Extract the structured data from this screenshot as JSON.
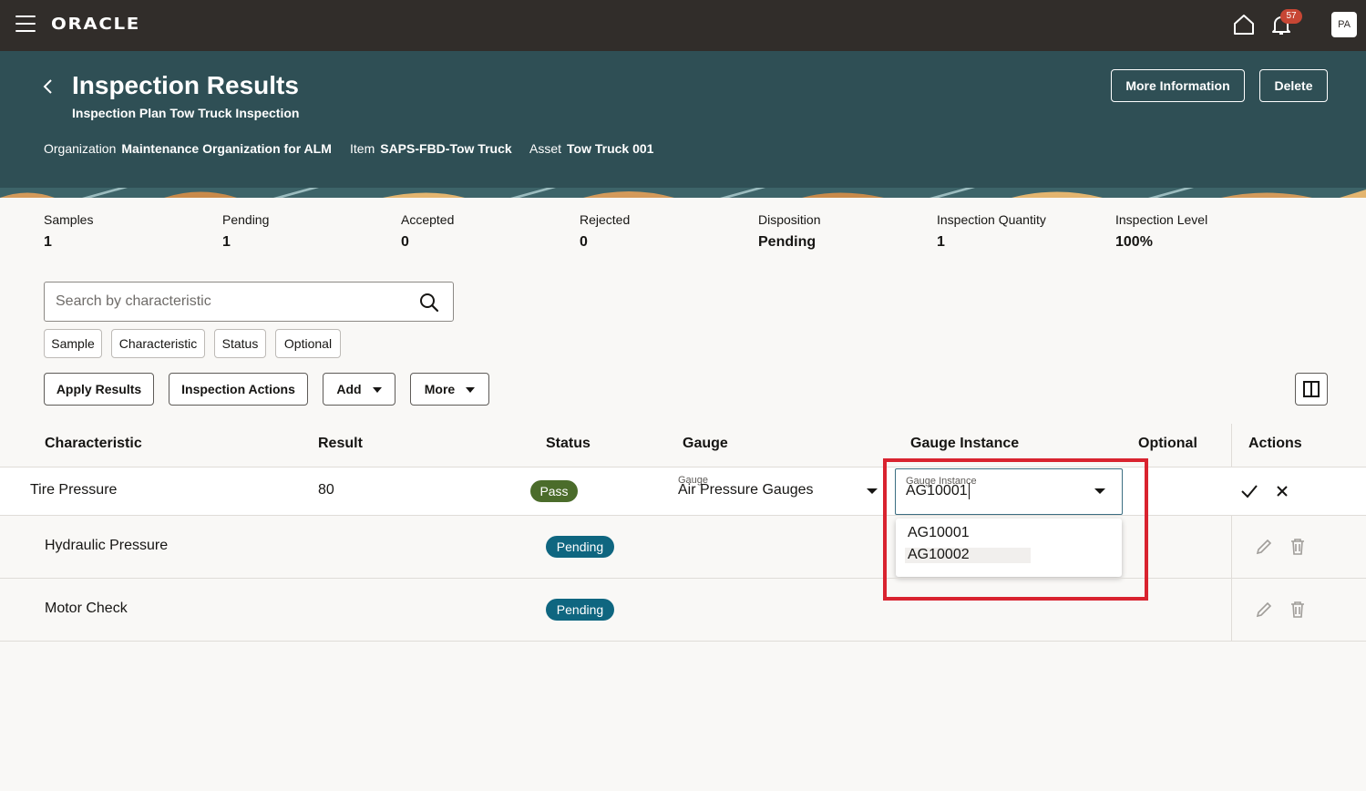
{
  "topbar": {
    "logo": "ORACLE",
    "notification_count": "57",
    "avatar_initials": "PA"
  },
  "header": {
    "title": "Inspection Results",
    "subtitle": "Inspection Plan Tow Truck Inspection",
    "context": [
      {
        "label": "Organization",
        "value": "Maintenance Organization for ALM"
      },
      {
        "label": "Item",
        "value": "SAPS-FBD-Tow Truck"
      },
      {
        "label": "Asset",
        "value": "Tow Truck 001"
      }
    ],
    "more_info_label": "More Information",
    "delete_label": "Delete",
    "colors": {
      "banner": "#2f4f55",
      "topbar": "#312d2a"
    }
  },
  "summary": [
    {
      "label": "Samples",
      "value": "1"
    },
    {
      "label": "Pending",
      "value": "1"
    },
    {
      "label": "Accepted",
      "value": "0"
    },
    {
      "label": "Rejected",
      "value": "0"
    },
    {
      "label": "Disposition",
      "value": "Pending"
    },
    {
      "label": "Inspection Quantity",
      "value": "1"
    },
    {
      "label": "Inspection Level",
      "value": "100%"
    }
  ],
  "search": {
    "placeholder": "Search by characteristic",
    "icon": "search-icon"
  },
  "filters": [
    "Sample",
    "Characteristic",
    "Status",
    "Optional"
  ],
  "toolbar": {
    "apply_results": "Apply Results",
    "inspection_actions": "Inspection Actions",
    "add": "Add",
    "more": "More"
  },
  "table": {
    "columns": [
      "Characteristic",
      "Result",
      "Status",
      "Gauge",
      "Gauge Instance",
      "Optional",
      "Actions"
    ],
    "rows": [
      {
        "characteristic": "Tire Pressure",
        "result": "80",
        "status": "Pass",
        "gauge_label": "Gauge",
        "gauge": "Air Pressure Gauges",
        "gauge_instance_label": "Gauge Instance",
        "gauge_instance": "AG10001"
      },
      {
        "characteristic": "Hydraulic Pressure",
        "result": "",
        "status": "Pending"
      },
      {
        "characteristic": "Motor Check",
        "result": "",
        "status": "Pending"
      }
    ],
    "status_colors": {
      "Pass": "#4b6c2b",
      "Pending": "#0f6680"
    }
  },
  "gauge_instance_options": [
    "AG10001",
    "AG10002"
  ]
}
